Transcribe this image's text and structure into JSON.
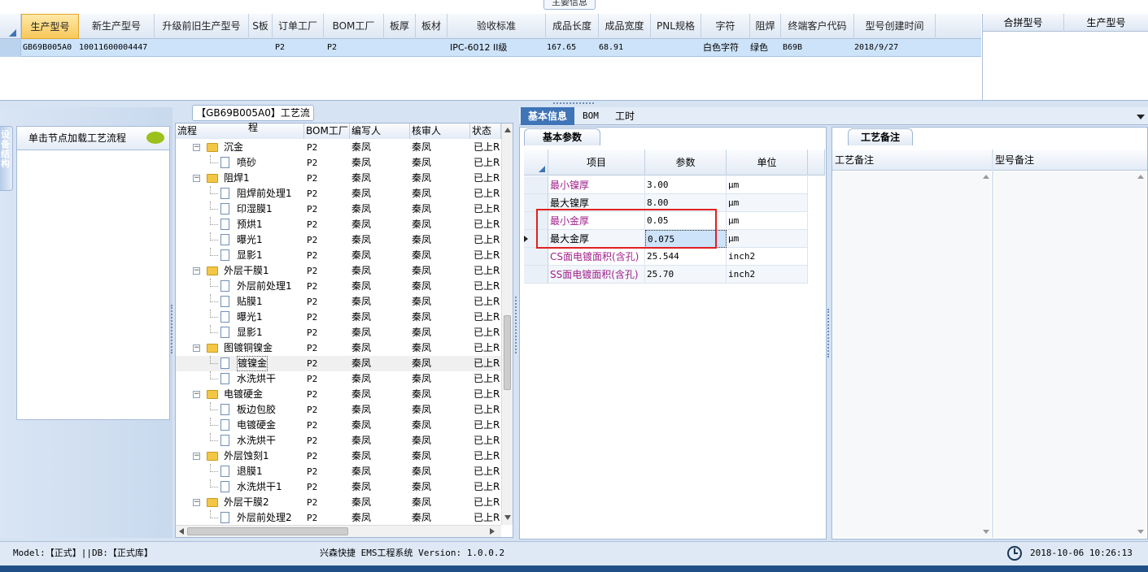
{
  "top": {
    "tab_title": "主要信息",
    "columns": [
      "生产型号",
      "新生产型号",
      "升级前旧生产型号",
      "S板",
      "订单工厂",
      "BOM工厂",
      "板厚",
      "板材",
      "验收标准",
      "成品长度",
      "成品宽度",
      "PNL规格",
      "字符",
      "阻焊",
      "终端客户代码",
      "型号创建时间"
    ],
    "row": [
      "GB69B005A0",
      "10011600004447",
      "",
      "",
      "P2",
      "P2",
      "",
      "",
      "IPC-6012 II级",
      "167.65",
      "68.91",
      "",
      "白色字符",
      "绿色",
      "B69B",
      "2018/9/27"
    ],
    "right_columns": [
      "合拼型号",
      "生产型号"
    ]
  },
  "left": {
    "side_tab": "设备结构",
    "load_label": "单击节点加载工艺流程"
  },
  "flow": {
    "title": "【GB69B005A0】工艺流程",
    "columns": [
      "流程",
      "BOM工厂",
      "编写人",
      "核审人",
      "状态"
    ],
    "rows": [
      {
        "name": "沉金",
        "level": 1,
        "folder": true,
        "bom": "P2",
        "writer": "秦凤",
        "reviewer": "秦凤",
        "status": "已上R"
      },
      {
        "name": "喷砂",
        "level": 2,
        "folder": false,
        "bom": "P2",
        "writer": "秦凤",
        "reviewer": "秦凤",
        "status": "已上R"
      },
      {
        "name": "阻焊1",
        "level": 1,
        "folder": true,
        "bom": "P2",
        "writer": "秦凤",
        "reviewer": "秦凤",
        "status": "已上R"
      },
      {
        "name": "阻焊前处理1",
        "level": 2,
        "folder": false,
        "bom": "P2",
        "writer": "秦凤",
        "reviewer": "秦凤",
        "status": "已上R"
      },
      {
        "name": "印湿膜1",
        "level": 2,
        "folder": false,
        "bom": "P2",
        "writer": "秦凤",
        "reviewer": "秦凤",
        "status": "已上R"
      },
      {
        "name": "预烘1",
        "level": 2,
        "folder": false,
        "bom": "P2",
        "writer": "秦凤",
        "reviewer": "秦凤",
        "status": "已上R"
      },
      {
        "name": "曝光1",
        "level": 2,
        "folder": false,
        "bom": "P2",
        "writer": "秦凤",
        "reviewer": "秦凤",
        "status": "已上R"
      },
      {
        "name": "显影1",
        "level": 2,
        "folder": false,
        "bom": "P2",
        "writer": "秦凤",
        "reviewer": "秦凤",
        "status": "已上R"
      },
      {
        "name": "外层干膜1",
        "level": 1,
        "folder": true,
        "bom": "P2",
        "writer": "秦凤",
        "reviewer": "秦凤",
        "status": "已上R"
      },
      {
        "name": "外层前处理1",
        "level": 2,
        "folder": false,
        "bom": "P2",
        "writer": "秦凤",
        "reviewer": "秦凤",
        "status": "已上R"
      },
      {
        "name": "贴膜1",
        "level": 2,
        "folder": false,
        "bom": "P2",
        "writer": "秦凤",
        "reviewer": "秦凤",
        "status": "已上R"
      },
      {
        "name": "曝光1",
        "level": 2,
        "folder": false,
        "bom": "P2",
        "writer": "秦凤",
        "reviewer": "秦凤",
        "status": "已上R"
      },
      {
        "name": "显影1",
        "level": 2,
        "folder": false,
        "bom": "P2",
        "writer": "秦凤",
        "reviewer": "秦凤",
        "status": "已上R"
      },
      {
        "name": "图镀铜镍金",
        "level": 1,
        "folder": true,
        "bom": "P2",
        "writer": "秦凤",
        "reviewer": "秦凤",
        "status": "已上R"
      },
      {
        "name": "镀镍金",
        "level": 2,
        "folder": false,
        "bom": "P2",
        "writer": "秦凤",
        "reviewer": "秦凤",
        "status": "已上R"
      },
      {
        "name": "水洗烘干",
        "level": 2,
        "folder": false,
        "bom": "P2",
        "writer": "秦凤",
        "reviewer": "秦凤",
        "status": "已上R"
      },
      {
        "name": "电镀硬金",
        "level": 1,
        "folder": true,
        "bom": "P2",
        "writer": "秦凤",
        "reviewer": "秦凤",
        "status": "已上R"
      },
      {
        "name": "板边包胶",
        "level": 2,
        "folder": false,
        "bom": "P2",
        "writer": "秦凤",
        "reviewer": "秦凤",
        "status": "已上R"
      },
      {
        "name": "电镀硬金",
        "level": 2,
        "folder": false,
        "bom": "P2",
        "writer": "秦凤",
        "reviewer": "秦凤",
        "status": "已上R"
      },
      {
        "name": "水洗烘干",
        "level": 2,
        "folder": false,
        "bom": "P2",
        "writer": "秦凤",
        "reviewer": "秦凤",
        "status": "已上R"
      },
      {
        "name": "外层蚀刻1",
        "level": 1,
        "folder": true,
        "bom": "P2",
        "writer": "秦凤",
        "reviewer": "秦凤",
        "status": "已上R"
      },
      {
        "name": "退膜1",
        "level": 2,
        "folder": false,
        "bom": "P2",
        "writer": "秦凤",
        "reviewer": "秦凤",
        "status": "已上R"
      },
      {
        "name": "水洗烘干1",
        "level": 2,
        "folder": false,
        "bom": "P2",
        "writer": "秦凤",
        "reviewer": "秦凤",
        "status": "已上R"
      },
      {
        "name": "外层干膜2",
        "level": 1,
        "folder": true,
        "bom": "P2",
        "writer": "秦凤",
        "reviewer": "秦凤",
        "status": "已上R"
      },
      {
        "name": "外层前处理2",
        "level": 2,
        "folder": false,
        "bom": "P2",
        "writer": "秦凤",
        "reviewer": "秦凤",
        "status": "已上R"
      }
    ],
    "selected_row": "镀镍金"
  },
  "detail": {
    "tabs": [
      "基本信息",
      "BOM",
      "工时"
    ],
    "subtab": "基本参数",
    "columns": [
      "项目",
      "参数",
      "单位"
    ],
    "rows": [
      {
        "item": "最小镍厚",
        "value": "3.00",
        "unit": "μm",
        "color": "#a0208a"
      },
      {
        "item": "最大镍厚",
        "value": "8.00",
        "unit": "μm",
        "color": "#000000"
      },
      {
        "item": "最小金厚",
        "value": "0.05",
        "unit": "μm",
        "color": "#a0208a"
      },
      {
        "item": "最大金厚",
        "value": "0.075",
        "unit": "μm",
        "color": "#000000"
      },
      {
        "item": "CS面电镀面积(含孔)",
        "value": "25.544",
        "unit": "inch2",
        "color": "#a0208a"
      },
      {
        "item": "SS面电镀面积(含孔)",
        "value": "25.70",
        "unit": "inch2",
        "color": "#a0208a"
      }
    ]
  },
  "notes": {
    "tab": "工艺备注",
    "columns": [
      "工艺备注",
      "型号备注"
    ]
  },
  "status": {
    "left": "Model:【正式】||DB:【正式库】",
    "center": "兴森快捷 EMS工程系统 Version: 1.0.0.2",
    "time": "2018-10-06 10:26:13"
  },
  "colors": {
    "accent": "#3f74b7",
    "highlight_box": "#e02020",
    "selection": "#cde3fa"
  }
}
